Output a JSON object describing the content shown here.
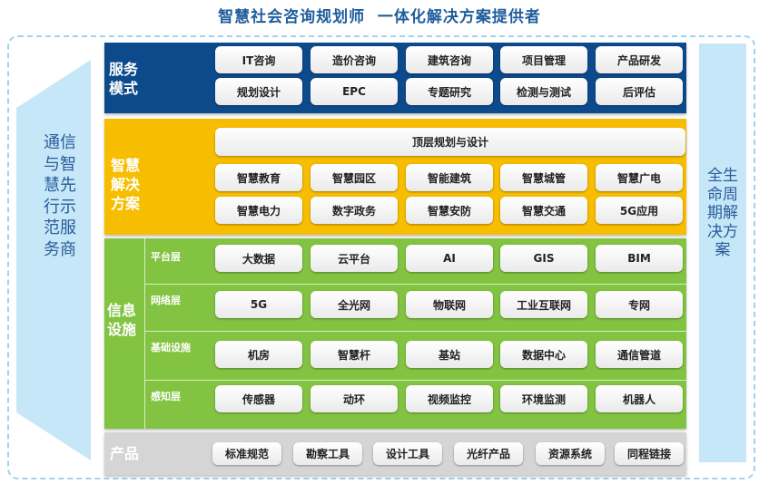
{
  "title": "智慧社会咨询规划师  一体化解决方案提供者",
  "left_banner": "通信与智慧先行示范服务商",
  "right_banner": "全生命周期解决方案",
  "service": {
    "label": "服务模式",
    "items": [
      "IT咨询",
      "造价咨询",
      "建筑咨询",
      "项目管理",
      "产品研发",
      "规划设计",
      "EPC",
      "专题研究",
      "检测与测试",
      "后评估"
    ]
  },
  "smart": {
    "label": "智慧解决方案",
    "top": "顶层规划与设计",
    "items": [
      "智慧教育",
      "智慧园区",
      "智能建筑",
      "智慧城管",
      "智慧广电",
      "智慧电力",
      "数字政务",
      "智慧安防",
      "智慧交通",
      "5G应用"
    ]
  },
  "info": {
    "label": "信息设施",
    "layers": [
      {
        "name": "平台层",
        "items": [
          "大数据",
          "云平台",
          "AI",
          "GIS",
          "BIM"
        ]
      },
      {
        "name": "网络层",
        "items": [
          "5G",
          "全光网",
          "物联网",
          "工业互联网",
          "专网"
        ]
      },
      {
        "name": "基础设施",
        "items": [
          "机房",
          "智慧杆",
          "基站",
          "数据中心",
          "通信管道"
        ]
      },
      {
        "name": "感知层",
        "items": [
          "传感器",
          "动环",
          "视频监控",
          "环境监测",
          "机器人"
        ]
      }
    ]
  },
  "product": {
    "label": "产品",
    "items": [
      "标准规范",
      "勘察工具",
      "设计工具",
      "光纤产品",
      "资源系统",
      "同程链接"
    ]
  },
  "colors": {
    "service_bg": "#0d4a8c",
    "smart_bg": "#f7bd00",
    "info_bg": "#82c341",
    "product_bg": "#d5d5d5",
    "banner_bg": "#c6e7f7",
    "title": "#1f5d9c"
  }
}
